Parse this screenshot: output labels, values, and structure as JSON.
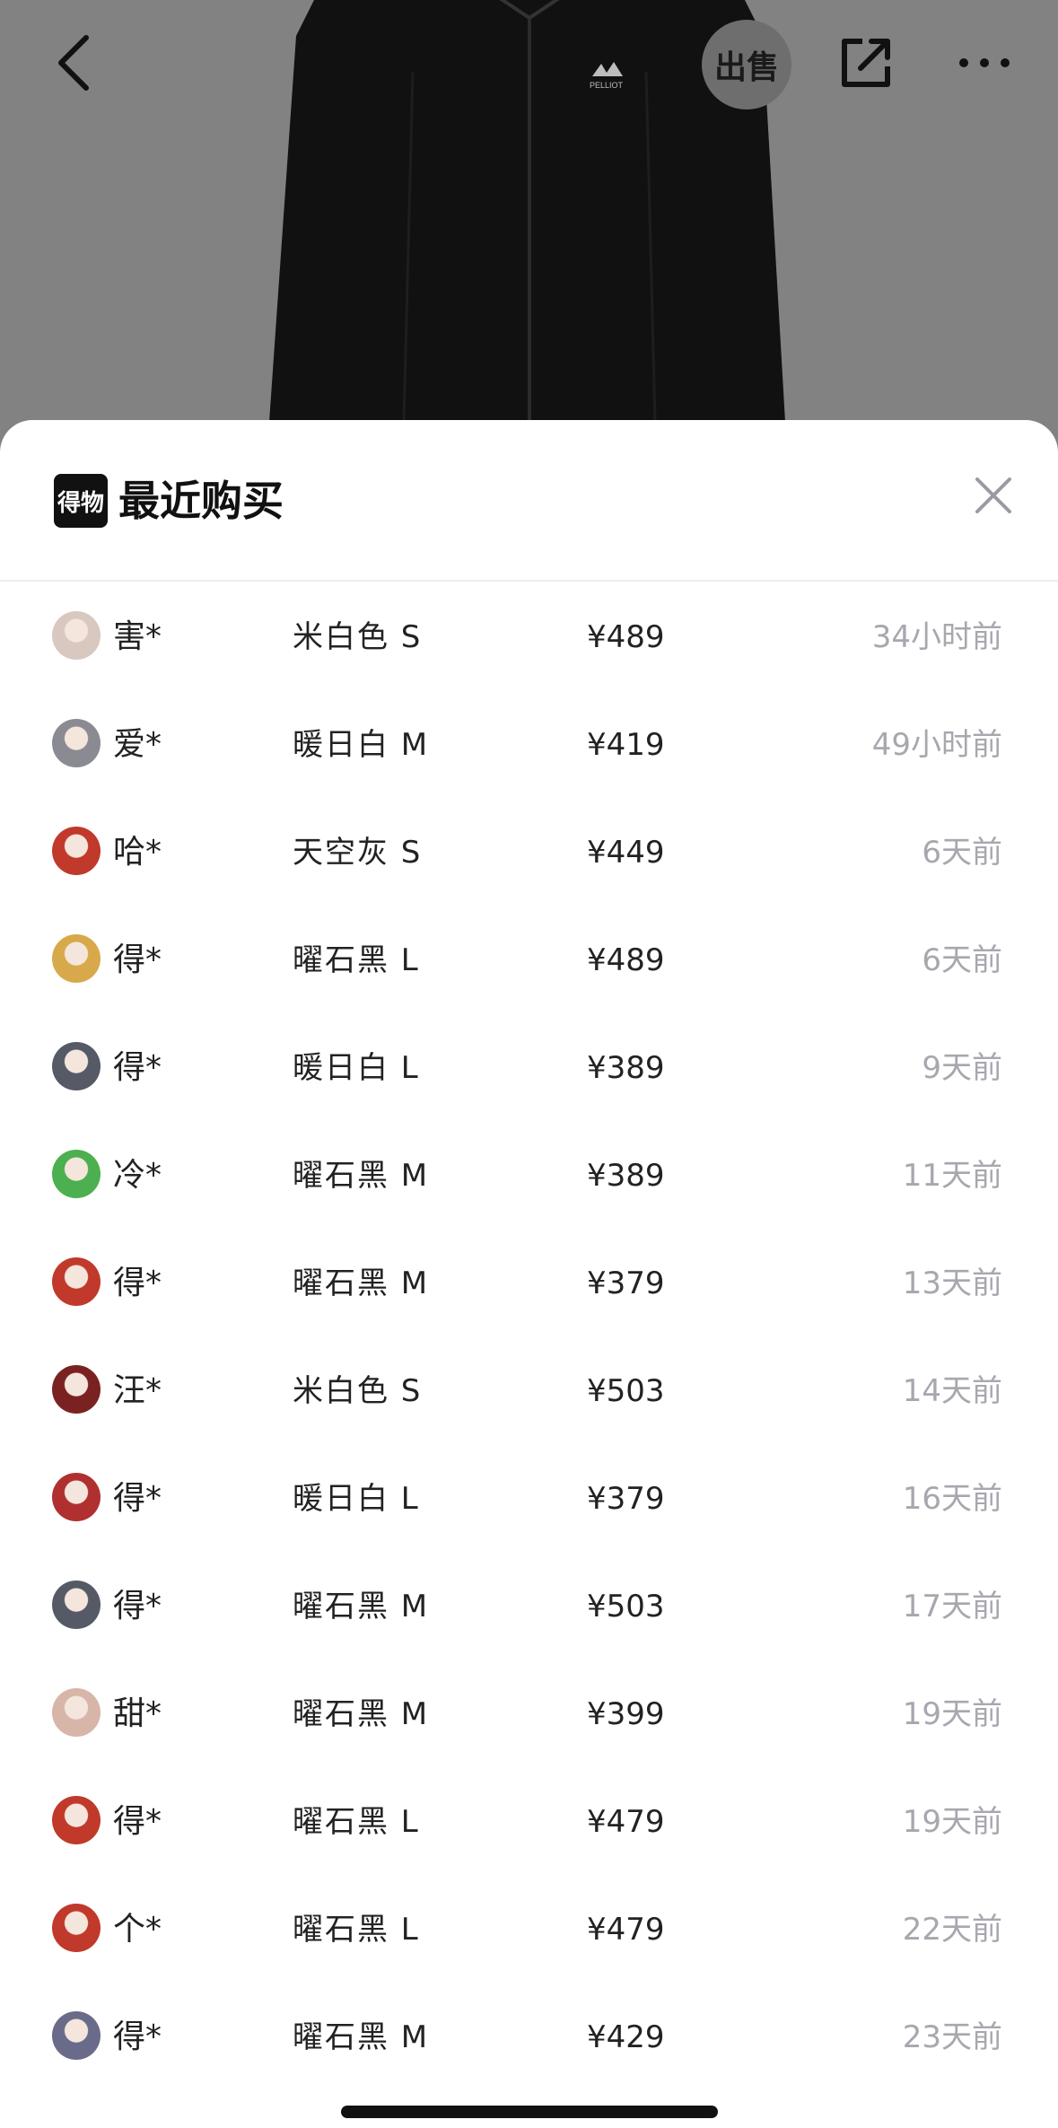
{
  "top_bar": {
    "sell_label": "出售",
    "back_icon": "chevron-left-icon",
    "share_icon": "share-icon",
    "more_icon": "more-icon"
  },
  "product": {
    "brand_print": "PELLIOT",
    "color": "#111111"
  },
  "sheet": {
    "logo_text": "得物",
    "title": "最近购买",
    "close_icon": "close-icon",
    "purchases": [
      {
        "buyer": "害*",
        "sku": "米白色 S",
        "price": "¥489",
        "time": "34小时前",
        "avatar_color": "#d8c8c0"
      },
      {
        "buyer": "爱*",
        "sku": "暖日白 M",
        "price": "¥419",
        "time": "49小时前",
        "avatar_color": "#8a8a92"
      },
      {
        "buyer": "哈*",
        "sku": "天空灰 S",
        "price": "¥449",
        "time": "6天前",
        "avatar_color": "#c0392b"
      },
      {
        "buyer": "得*",
        "sku": "曜石黑 L",
        "price": "¥489",
        "time": "6天前",
        "avatar_color": "#d8a94a"
      },
      {
        "buyer": "得*",
        "sku": "暖日白 L",
        "price": "¥389",
        "time": "9天前",
        "avatar_color": "#555a66"
      },
      {
        "buyer": "冷*",
        "sku": "曜石黑 M",
        "price": "¥389",
        "time": "11天前",
        "avatar_color": "#4caf50"
      },
      {
        "buyer": "得*",
        "sku": "曜石黑 M",
        "price": "¥379",
        "time": "13天前",
        "avatar_color": "#c0392b"
      },
      {
        "buyer": "汪*",
        "sku": "米白色 S",
        "price": "¥503",
        "time": "14天前",
        "avatar_color": "#7a2222"
      },
      {
        "buyer": "得*",
        "sku": "暖日白 L",
        "price": "¥379",
        "time": "16天前",
        "avatar_color": "#b03030"
      },
      {
        "buyer": "得*",
        "sku": "曜石黑 M",
        "price": "¥503",
        "time": "17天前",
        "avatar_color": "#555a66"
      },
      {
        "buyer": "甜*",
        "sku": "曜石黑 M",
        "price": "¥399",
        "time": "19天前",
        "avatar_color": "#d7b5a8"
      },
      {
        "buyer": "得*",
        "sku": "曜石黑 L",
        "price": "¥479",
        "time": "19天前",
        "avatar_color": "#c0392b"
      },
      {
        "buyer": "个*",
        "sku": "曜石黑 L",
        "price": "¥479",
        "time": "22天前",
        "avatar_color": "#c0392b"
      },
      {
        "buyer": "得*",
        "sku": "曜石黑 M",
        "price": "¥429",
        "time": "23天前",
        "avatar_color": "#6a6a8a"
      }
    ]
  }
}
